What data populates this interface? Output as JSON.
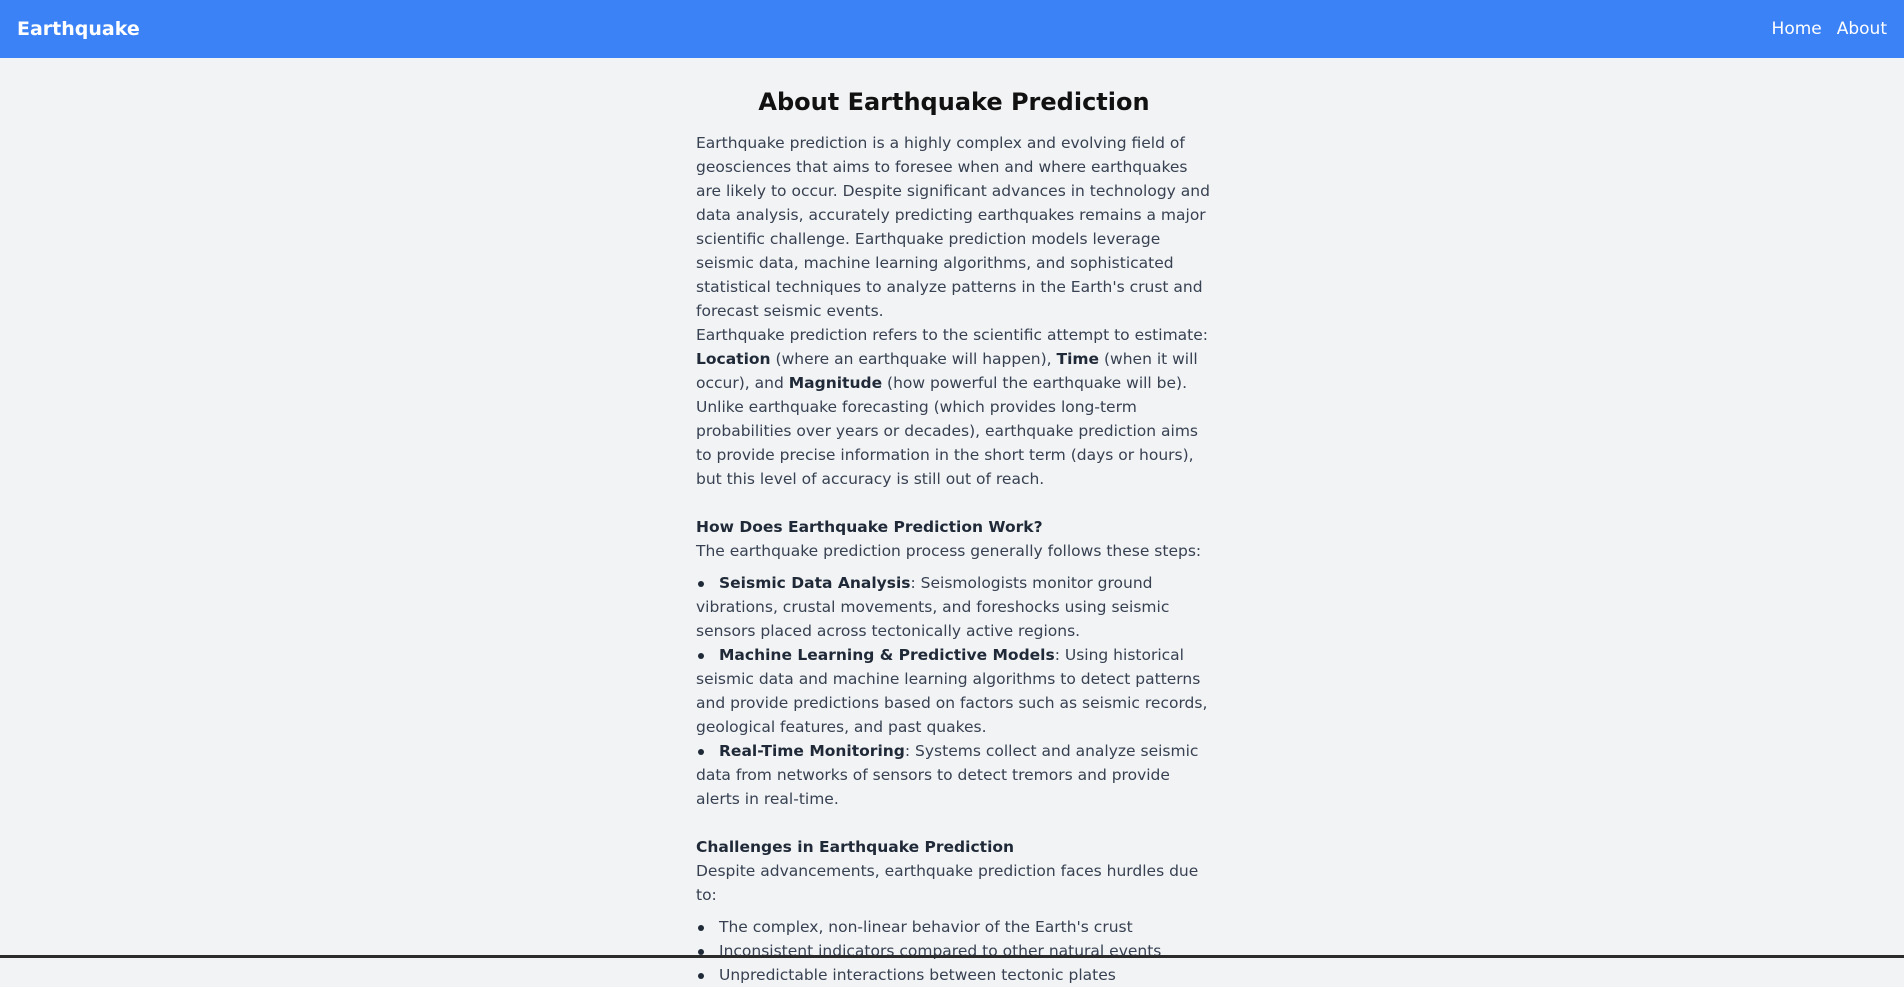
{
  "nav": {
    "brand": "Earthquake",
    "links": [
      "Home",
      "About"
    ]
  },
  "main": {
    "title": "About Earthquake Prediction",
    "intro": "Earthquake prediction is a highly complex and evolving field of geosciences that aims to foresee when and where earthquakes are likely to occur. Despite significant advances in technology and data analysis, accurately predicting earthquakes remains a major scientific challenge. Earthquake prediction models leverage seismic data, machine learning algorithms, and sophisticated statistical techniques to analyze patterns in the Earth's crust and forecast seismic events.",
    "definition": {
      "lead": "Earthquake prediction refers to the scientific attempt to estimate:",
      "term1": "Location",
      "desc1": " (where an earthquake will happen), ",
      "term2": "Time",
      "desc2": " (when it will occur), and ",
      "term3": "Magnitude",
      "desc3": " (how powerful the earthquake will be). Unlike earthquake forecasting (which provides long-term probabilities over years or decades), earthquake prediction aims to provide precise information in the short term (days or hours), but this level of accuracy is still out of reach."
    },
    "how": {
      "heading": "How Does Earthquake Prediction Work?",
      "intro": "The earthquake prediction process generally follows these steps:",
      "steps": [
        {
          "term": "Seismic Data Analysis",
          "text": ": Seismologists monitor ground vibrations, crustal movements, and foreshocks using seismic sensors placed across tectonically active regions."
        },
        {
          "term": "Machine Learning & Predictive Models",
          "text": ": Using historical seismic data and machine learning algorithms to detect patterns and provide predictions based on factors such as seismic records, geological features, and past quakes."
        },
        {
          "term": "Real-Time Monitoring",
          "text": ": Systems collect and analyze seismic data from networks of sensors to detect tremors and provide alerts in real-time."
        }
      ]
    },
    "challenges": {
      "heading": "Challenges in Earthquake Prediction",
      "intro": "Despite advancements, earthquake prediction faces hurdles due to:",
      "items": [
        "The complex, non-linear behavior of the Earth's crust",
        "Inconsistent indicators compared to other natural events",
        "Unpredictable interactions between tectonic plates"
      ]
    }
  },
  "colors": {
    "navbar": "#3b82f6",
    "background": "#f2f3f5",
    "text": "#374151"
  }
}
